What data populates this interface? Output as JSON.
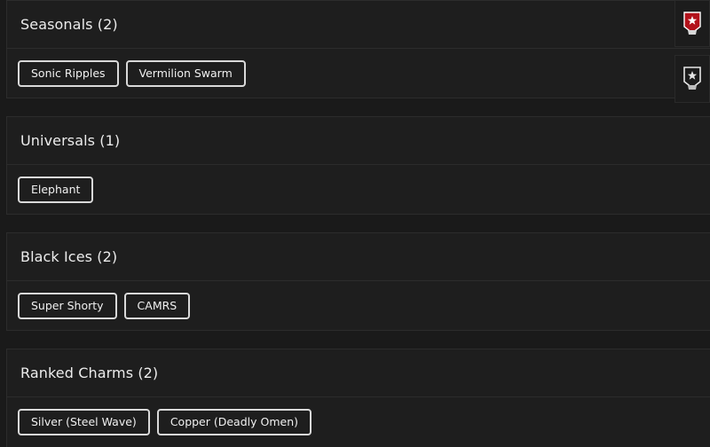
{
  "sections": [
    {
      "title": "Seasonals (2)",
      "tags": [
        "Sonic Ripples",
        "Vermilion Swarm"
      ]
    },
    {
      "title": "Universals (1)",
      "tags": [
        "Elephant"
      ]
    },
    {
      "title": "Black Ices (2)",
      "tags": [
        "Super Shorty",
        "CAMRS"
      ]
    },
    {
      "title": "Ranked Charms (2)",
      "tags": [
        "Silver (Steel Wave)",
        "Copper (Deadly Omen)"
      ]
    }
  ],
  "side_icons": [
    {
      "icon": "red-banner-icon",
      "color": "#b3121b"
    },
    {
      "icon": "white-banner-icon",
      "color": "#e6e6e6"
    }
  ]
}
